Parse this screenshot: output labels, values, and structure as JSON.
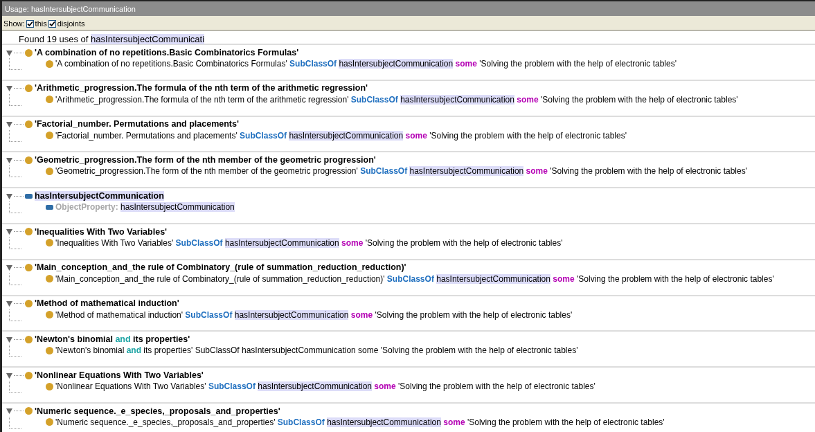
{
  "window": {
    "title": "Usage: hasIntersubjectCommunication"
  },
  "show": {
    "label": "Show:",
    "options": [
      {
        "label": "this",
        "checked": true
      },
      {
        "label": "disjoints",
        "checked": true
      }
    ]
  },
  "found": [
    {
      "kind": "text",
      "text": "Found 19 uses of "
    },
    {
      "kind": "highlight",
      "text": "hasIntersubjectCommunicati"
    }
  ],
  "groups": [
    {
      "kind": "class",
      "expanded": true,
      "title": [
        {
          "kind": "text",
          "text": "'A combination of no repetitions.Basic Combinatorics Formulas'"
        }
      ],
      "axiom": {
        "kind": "class",
        "tokens": [
          {
            "kind": "text",
            "text": "'A combination of no repetitions.Basic Combinatorics Formulas' "
          },
          {
            "kind": "keyword",
            "text": "SubClassOf "
          },
          {
            "kind": "highlight",
            "text": "hasIntersubjectCommunication"
          },
          {
            "kind": "restriction",
            "text": " some"
          },
          {
            "kind": "text",
            "text": " 'Solving the problem with the help of electronic tables'"
          }
        ]
      }
    },
    {
      "kind": "class",
      "expanded": true,
      "title": [
        {
          "kind": "text",
          "text": "'Arithmetic_progression.The formula of the nth term of the arithmetic regression'"
        }
      ],
      "axiom": {
        "kind": "class",
        "tokens": [
          {
            "kind": "text",
            "text": "'Arithmetic_progression.The formula of the nth term of the arithmetic regression' "
          },
          {
            "kind": "keyword",
            "text": "SubClassOf "
          },
          {
            "kind": "highlight",
            "text": "hasIntersubjectCommunication"
          },
          {
            "kind": "restriction",
            "text": " some"
          },
          {
            "kind": "text",
            "text": " 'Solving the problem with the help of electronic tables'"
          }
        ]
      }
    },
    {
      "kind": "class",
      "expanded": true,
      "title": [
        {
          "kind": "text",
          "text": "'Factorial_number. Permutations and placements'"
        }
      ],
      "axiom": {
        "kind": "class",
        "tokens": [
          {
            "kind": "text",
            "text": "'Factorial_number. Permutations and placements' "
          },
          {
            "kind": "keyword",
            "text": "SubClassOf "
          },
          {
            "kind": "highlight",
            "text": "hasIntersubjectCommunication"
          },
          {
            "kind": "restriction",
            "text": " some"
          },
          {
            "kind": "text",
            "text": " 'Solving the problem with the help of electronic tables'"
          }
        ]
      }
    },
    {
      "kind": "class",
      "expanded": true,
      "title": [
        {
          "kind": "text",
          "text": "'Geometric_progression.The form of the nth member of the geometric progression'"
        }
      ],
      "axiom": {
        "kind": "class",
        "tokens": [
          {
            "kind": "text",
            "text": "'Geometric_progression.The form of the nth member of the geometric progression' "
          },
          {
            "kind": "keyword",
            "text": "SubClassOf "
          },
          {
            "kind": "highlight",
            "text": "hasIntersubjectCommunication"
          },
          {
            "kind": "restriction",
            "text": " some"
          },
          {
            "kind": "text",
            "text": " 'Solving the problem with the help of electronic tables'"
          }
        ]
      }
    },
    {
      "kind": "property",
      "expanded": true,
      "title": [
        {
          "kind": "highlight",
          "text": "hasIntersubjectCommunication"
        }
      ],
      "axiom": {
        "kind": "property",
        "tokens": [
          {
            "kind": "label",
            "text": "ObjectProperty: "
          },
          {
            "kind": "highlight",
            "text": "hasIntersubjectCommunication"
          }
        ]
      }
    },
    {
      "kind": "class",
      "expanded": true,
      "title": [
        {
          "kind": "text",
          "text": "'Inequalities With Two Variables'"
        }
      ],
      "axiom": {
        "kind": "class",
        "tokens": [
          {
            "kind": "text",
            "text": "'Inequalities With Two Variables' "
          },
          {
            "kind": "keyword",
            "text": "SubClassOf "
          },
          {
            "kind": "highlight",
            "text": "hasIntersubjectCommunication"
          },
          {
            "kind": "restriction",
            "text": " some"
          },
          {
            "kind": "text",
            "text": " 'Solving the problem with the help of electronic tables'"
          }
        ]
      }
    },
    {
      "kind": "class",
      "expanded": true,
      "title": [
        {
          "kind": "text",
          "text": "'Main_conception_and_the rule of Combinatory_(rule of summation_reduction_reduction)'"
        }
      ],
      "axiom": {
        "kind": "class",
        "tokens": [
          {
            "kind": "text",
            "text": "'Main_conception_and_the rule of Combinatory_(rule of summation_reduction_reduction)' "
          },
          {
            "kind": "keyword",
            "text": "SubClassOf "
          },
          {
            "kind": "highlight",
            "text": "hasIntersubjectCommunication"
          },
          {
            "kind": "restriction",
            "text": " some"
          },
          {
            "kind": "text",
            "text": " 'Solving the problem with the help of electronic tables'"
          }
        ]
      }
    },
    {
      "kind": "class",
      "expanded": true,
      "title": [
        {
          "kind": "text",
          "text": "'Method of mathematical induction'"
        }
      ],
      "axiom": {
        "kind": "class",
        "tokens": [
          {
            "kind": "text",
            "text": "'Method of mathematical induction' "
          },
          {
            "kind": "keyword",
            "text": "SubClassOf "
          },
          {
            "kind": "highlight",
            "text": "hasIntersubjectCommunication"
          },
          {
            "kind": "restriction",
            "text": " some"
          },
          {
            "kind": "text",
            "text": " 'Solving the problem with the help of electronic tables'"
          }
        ]
      }
    },
    {
      "kind": "class",
      "expanded": true,
      "title": [
        {
          "kind": "text",
          "text": "'Newton's binomial "
        },
        {
          "kind": "operator",
          "text": "and"
        },
        {
          "kind": "text",
          "text": " its properties'"
        }
      ],
      "axiom": {
        "kind": "class",
        "tokens": [
          {
            "kind": "text",
            "text": "'Newton's binomial "
          },
          {
            "kind": "operator",
            "text": "and"
          },
          {
            "kind": "text",
            "text": " its properties' SubClassOf hasIntersubjectCommunication some 'Solving the problem with the help of electronic tables'"
          }
        ]
      }
    },
    {
      "kind": "class",
      "expanded": true,
      "title": [
        {
          "kind": "text",
          "text": "'Nonlinear Equations With Two Variables'"
        }
      ],
      "axiom": {
        "kind": "class",
        "tokens": [
          {
            "kind": "text",
            "text": "'Nonlinear Equations With Two Variables' "
          },
          {
            "kind": "keyword",
            "text": "SubClassOf "
          },
          {
            "kind": "highlight",
            "text": "hasIntersubjectCommunication"
          },
          {
            "kind": "restriction",
            "text": " some"
          },
          {
            "kind": "text",
            "text": " 'Solving the problem with the help of electronic tables'"
          }
        ]
      }
    },
    {
      "kind": "class",
      "expanded": true,
      "title": [
        {
          "kind": "text",
          "text": "'Numeric sequence._e_species,_proposals_and_properties'"
        }
      ],
      "axiom": {
        "kind": "class",
        "tokens": [
          {
            "kind": "text",
            "text": "'Numeric sequence._e_species,_proposals_and_properties' "
          },
          {
            "kind": "keyword",
            "text": "SubClassOf "
          },
          {
            "kind": "highlight",
            "text": "hasIntersubjectCommunication"
          },
          {
            "kind": "restriction",
            "text": " some"
          },
          {
            "kind": "text",
            "text": " 'Solving the problem with the help of electronic tables'"
          }
        ]
      }
    }
  ]
}
